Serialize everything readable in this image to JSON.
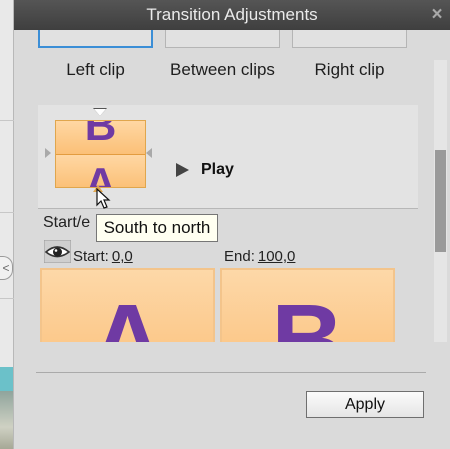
{
  "dialog": {
    "title": "Transition Adjustments",
    "close_glyph": "×"
  },
  "clip_tabs": [
    {
      "label": "Left clip"
    },
    {
      "label": "Between clips"
    },
    {
      "label": "Right clip"
    }
  ],
  "preview": {
    "mini_top_letter": "B",
    "mini_bottom_letter": "A",
    "play_label": "Play"
  },
  "start_end": {
    "label": "Start/e",
    "start_label": "Start:",
    "start_value": "0,0",
    "end_label": "End:",
    "end_value": "100,0"
  },
  "frames": {
    "start_letter": "A",
    "end_letter": "B"
  },
  "tooltip": "South to north",
  "footer": {
    "apply_label": "Apply"
  },
  "background": {
    "back_arrow": "<"
  },
  "colors": {
    "title_bar": "#444444",
    "active_tab_border": "#3b8ed6",
    "letter": "#6f3aa3",
    "frame_fill": "#fcc686",
    "tooltip_bg": "#fffff1"
  },
  "icons": [
    "close-icon",
    "arrow-top-icon",
    "arrow-left-icon",
    "arrow-right-icon",
    "arrow-bottom-icon",
    "play-icon",
    "eye-icon",
    "cursor-icon",
    "back-arrow-icon"
  ]
}
